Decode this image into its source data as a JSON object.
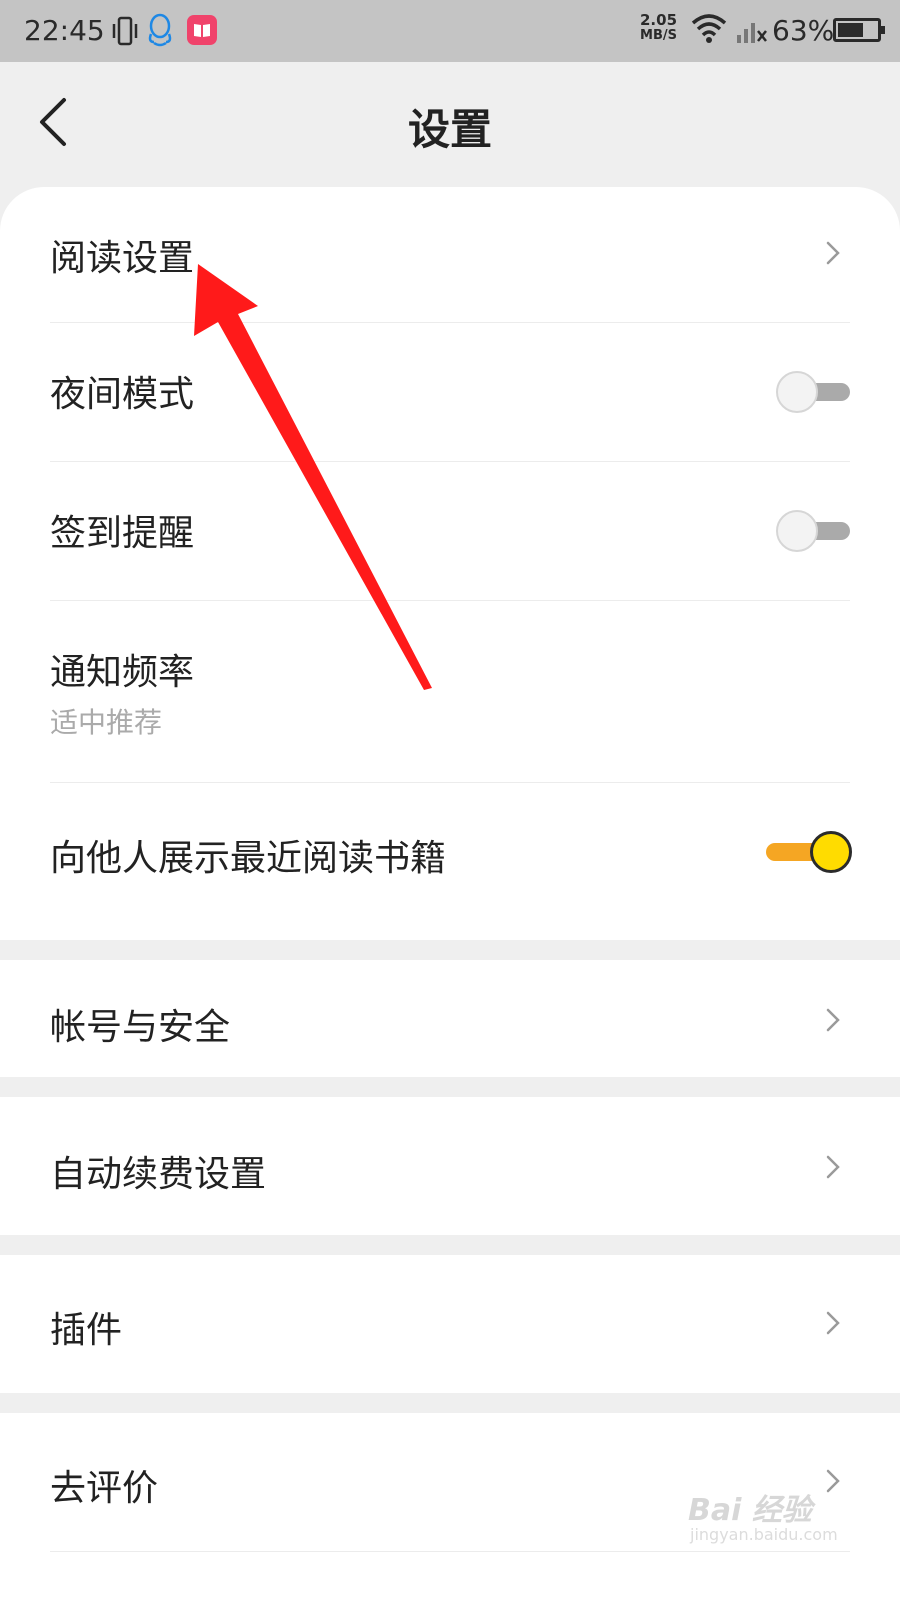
{
  "status_bar": {
    "time": "22:45",
    "speed_value": "2.05",
    "speed_unit": "MB/S",
    "battery": "63%",
    "icons": [
      "vibrate-icon",
      "qq-icon",
      "book-app-icon",
      "wifi-icon",
      "signal-icon",
      "battery-icon"
    ]
  },
  "header": {
    "title": "设置"
  },
  "settings": {
    "reading": {
      "label": "阅读设置"
    },
    "night_mode": {
      "label": "夜间模式",
      "enabled": false
    },
    "checkin_reminder": {
      "label": "签到提醒",
      "enabled": false
    },
    "notify_frequency": {
      "label": "通知频率",
      "value": "适中推荐"
    },
    "show_recent_books": {
      "label": "向他人展示最近阅读书籍",
      "enabled": true
    },
    "account_security": {
      "label": "帐号与安全"
    },
    "auto_renew": {
      "label": "自动续费设置"
    },
    "plugins": {
      "label": "插件"
    },
    "rate": {
      "label": "去评价"
    }
  },
  "watermark": {
    "brand": "Bai 经验",
    "url": "jingyan.baidu.com"
  },
  "colors": {
    "accent_track": "#f5a623",
    "accent_knob": "#ffdc00",
    "annotation_arrow": "#ff1a1a",
    "page_bg": "#efefef"
  }
}
